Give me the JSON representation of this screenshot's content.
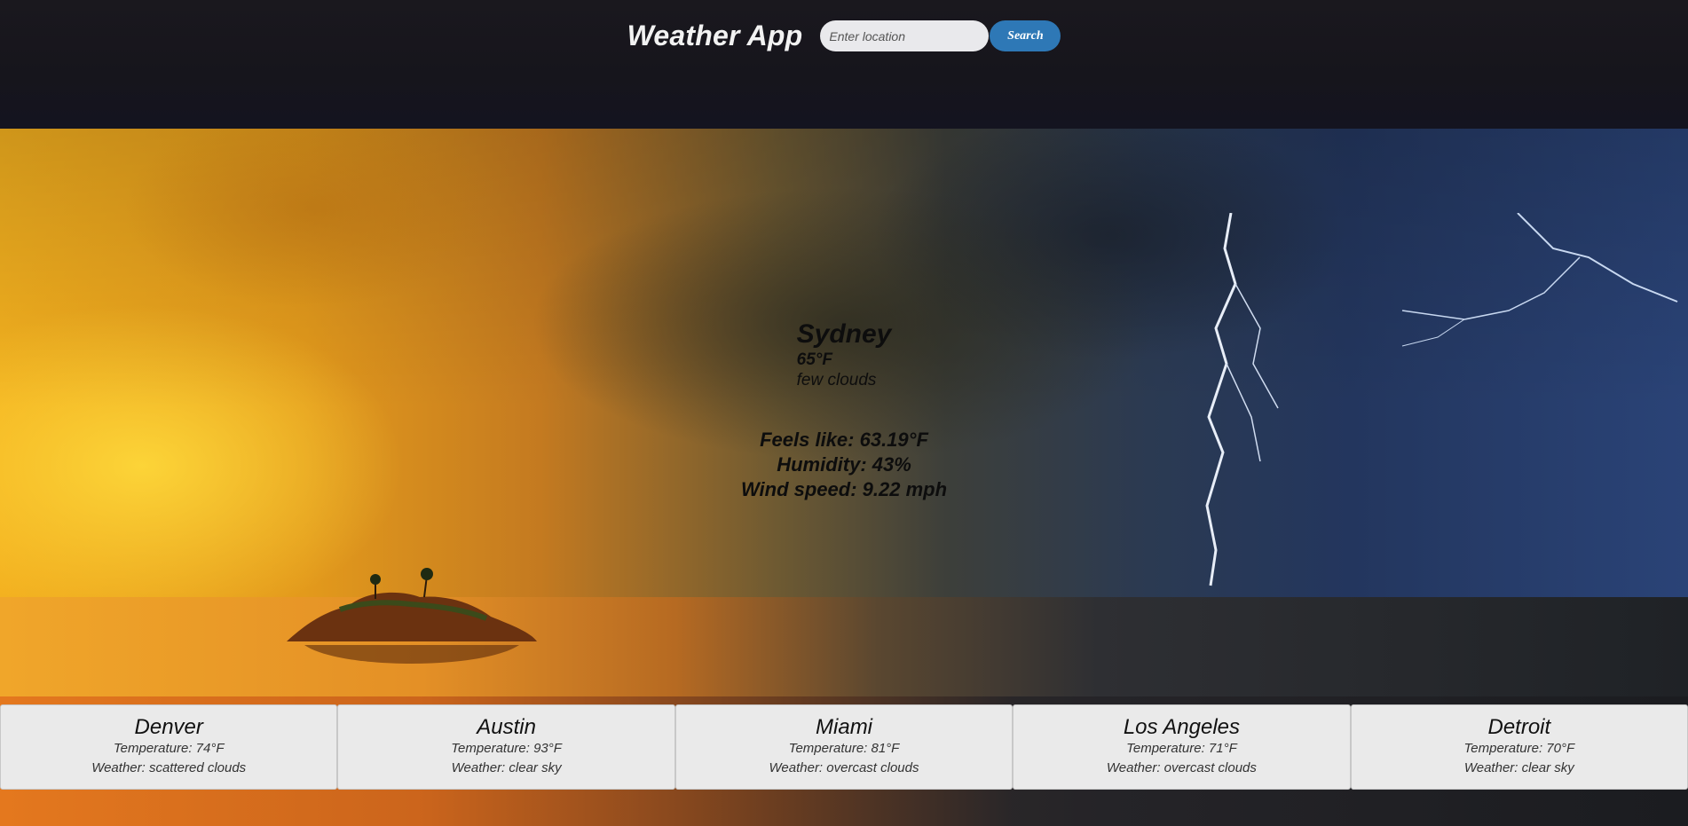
{
  "header": {
    "title": "Weather App",
    "search_placeholder": "Enter location",
    "search_button": "Search"
  },
  "current": {
    "city": "Sydney",
    "temperature": "65°F",
    "description": "few clouds",
    "feels_like": "Feels like: 63.19°F",
    "humidity": "Humidity: 43%",
    "wind_speed": "Wind speed: 9.22 mph"
  },
  "cities": [
    {
      "name": "Denver",
      "temperature": "Temperature: 74°F",
      "weather": "Weather: scattered clouds"
    },
    {
      "name": "Austin",
      "temperature": "Temperature: 93°F",
      "weather": "Weather: clear sky"
    },
    {
      "name": "Miami",
      "temperature": "Temperature: 81°F",
      "weather": "Weather: overcast clouds"
    },
    {
      "name": "Los Angeles",
      "temperature": "Temperature: 71°F",
      "weather": "Weather: overcast clouds"
    },
    {
      "name": "Detroit",
      "temperature": "Temperature: 70°F",
      "weather": "Weather: clear sky"
    }
  ],
  "colors": {
    "header_bg": "#17161d",
    "search_button": "#2e78b6",
    "card_bg": "#eaeaea"
  }
}
